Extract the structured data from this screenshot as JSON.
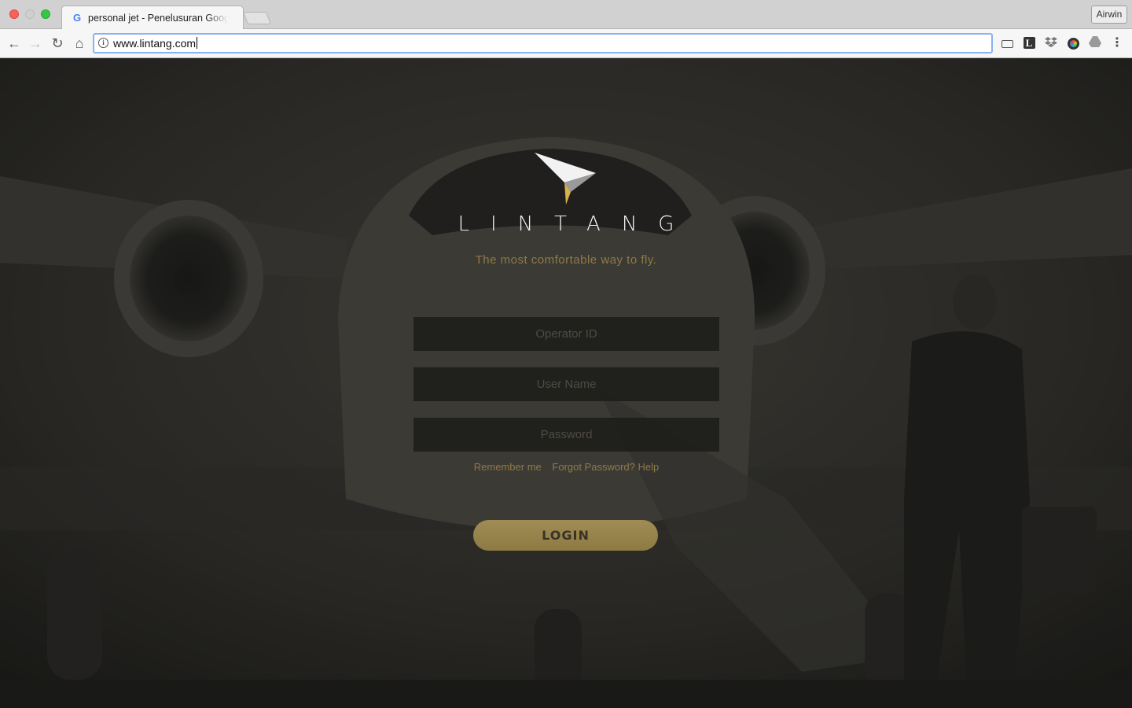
{
  "browser": {
    "tab_title": "personal jet - Penelusuran Google",
    "tab_favicon": "G",
    "tab_close": "×",
    "profile_name": "Airwin",
    "url": "www.lintang.com",
    "icons": {
      "back": "←",
      "forward": "→",
      "reload": "↻",
      "home": "⌂",
      "info": "i",
      "menu": "⋮",
      "extension_l": "L"
    }
  },
  "page": {
    "brand": "LINTANG",
    "tagline": "The most comfortable way to fly.",
    "fields": {
      "operator_id_placeholder": "Operator ID",
      "username_placeholder": "User Name",
      "password_placeholder": "Password"
    },
    "links": {
      "remember_me": "Remember me",
      "forgot_password": "Forgot Password? Help"
    },
    "login_label": "LOGIN",
    "colors": {
      "accent_gold": "#8f7a48",
      "button_gold": "#9a8650",
      "background": "#262624"
    }
  }
}
